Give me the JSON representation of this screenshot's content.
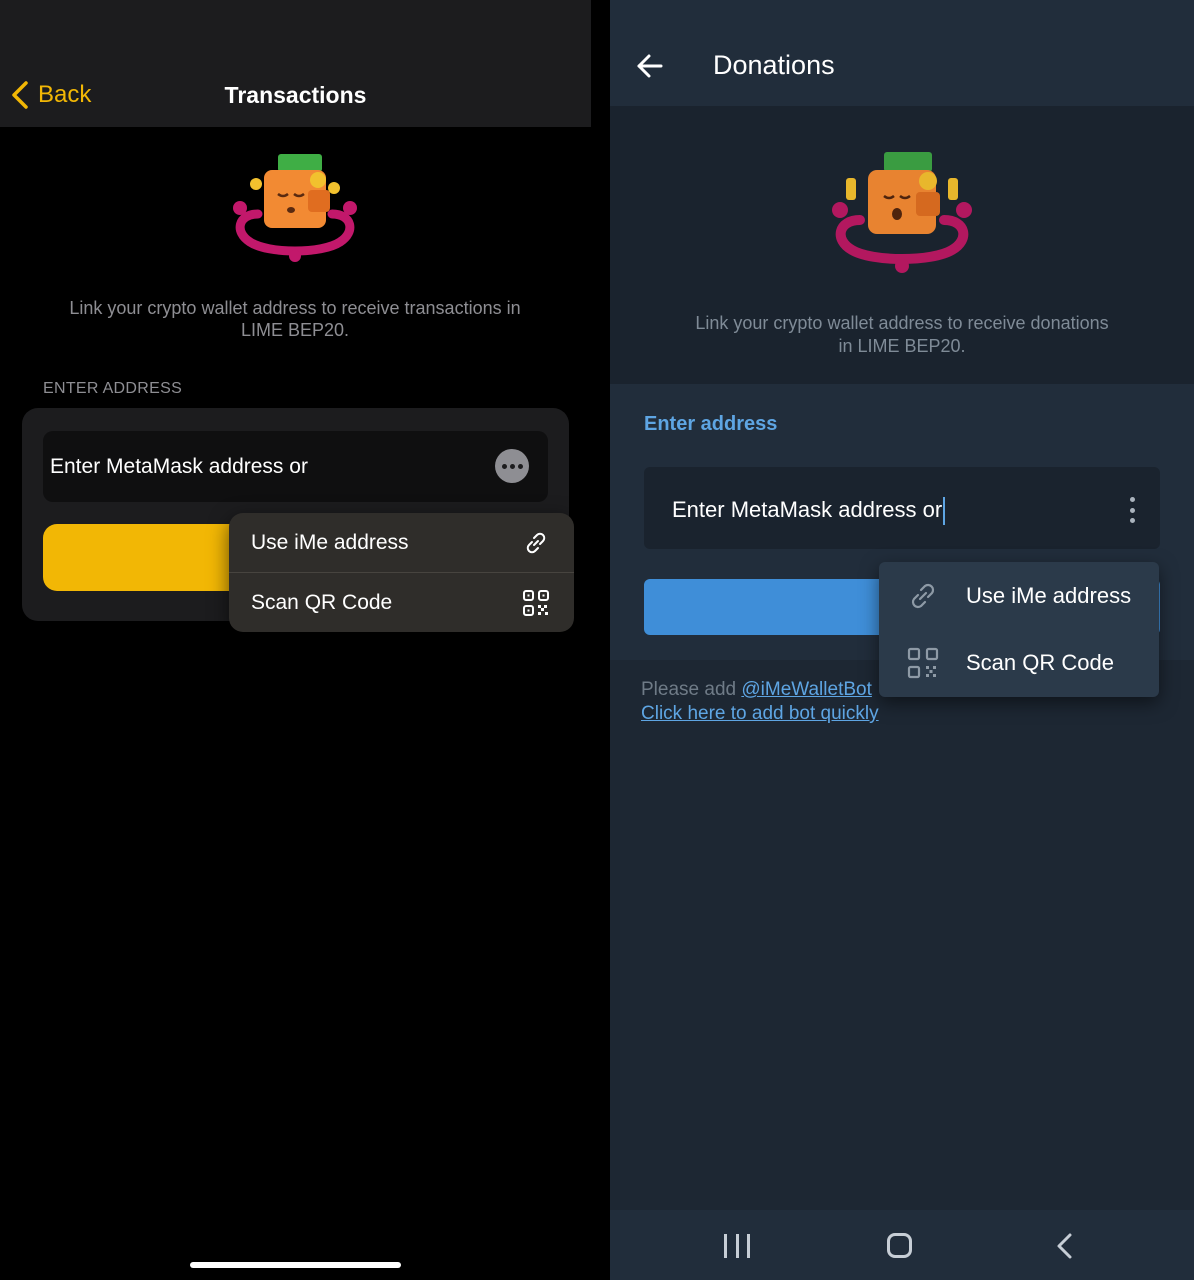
{
  "ios": {
    "back_label": "Back",
    "title": "Transactions",
    "description": "Link your crypto wallet address to receive transactions in LIME BEP20.",
    "section_label": "ENTER ADDRESS",
    "address_placeholder": "Enter MetaMask address or",
    "menu": [
      {
        "label": "Use iMe address",
        "icon": "link-icon"
      },
      {
        "label": "Scan QR Code",
        "icon": "qr-code-icon"
      }
    ],
    "colors": {
      "accent": "#f2b705",
      "background": "#000000",
      "card": "#1c1c1e"
    }
  },
  "android": {
    "title": "Donations",
    "description": "Link your crypto wallet address to receive donations in LIME BEP20.",
    "section_label": "Enter address",
    "address_value": "Enter MetaMask address or",
    "menu": [
      {
        "label": "Use iMe address",
        "icon": "link-icon"
      },
      {
        "label": "Scan QR Code",
        "icon": "qr-code-icon"
      }
    ],
    "footer_prefix": "Please add",
    "footer_bot_link": "@iMeWalletBot",
    "footer_add_link": "Click here to add bot quickly",
    "colors": {
      "accent": "#5ea5e3",
      "button": "#3f8ed8",
      "background": "#1d2733"
    }
  }
}
